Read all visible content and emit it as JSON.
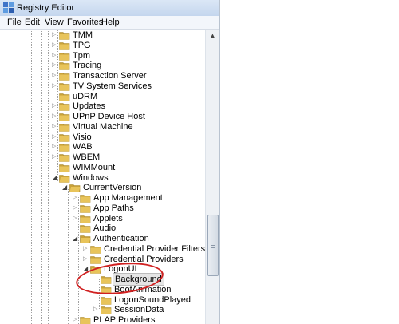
{
  "window": {
    "title": "Registry Editor"
  },
  "menu": [
    {
      "label": "File",
      "mnemonic": "F",
      "rest": "ile"
    },
    {
      "label": "Edit",
      "mnemonic": "E",
      "rest": "dit"
    },
    {
      "label": "View",
      "mnemonic": "V",
      "rest": "iew"
    },
    {
      "label": "Favorites",
      "mnemonic": "a",
      "prefix": "F",
      "rest": "vorites"
    },
    {
      "label": "Help",
      "mnemonic": "H",
      "rest": "elp"
    }
  ],
  "tree": {
    "items": [
      {
        "label": "TMM",
        "expanded": false,
        "has_children": true
      },
      {
        "label": "TPG",
        "expanded": false,
        "has_children": true
      },
      {
        "label": "Tpm",
        "expanded": false,
        "has_children": true
      },
      {
        "label": "Tracing",
        "expanded": false,
        "has_children": true
      },
      {
        "label": "Transaction Server",
        "expanded": false,
        "has_children": true
      },
      {
        "label": "TV System Services",
        "expanded": false,
        "has_children": true
      },
      {
        "label": "uDRM",
        "expanded": false,
        "has_children": false
      },
      {
        "label": "Updates",
        "expanded": false,
        "has_children": true
      },
      {
        "label": "UPnP Device Host",
        "expanded": false,
        "has_children": true
      },
      {
        "label": "Virtual Machine",
        "expanded": false,
        "has_children": true
      },
      {
        "label": "Visio",
        "expanded": false,
        "has_children": true
      },
      {
        "label": "WAB",
        "expanded": false,
        "has_children": true
      },
      {
        "label": "WBEM",
        "expanded": false,
        "has_children": true
      },
      {
        "label": "WIMMount",
        "expanded": false,
        "has_children": false
      },
      {
        "label": "Windows",
        "expanded": true,
        "has_children": true
      },
      {
        "label": "CurrentVersion",
        "expanded": true,
        "has_children": true
      },
      {
        "label": "App Management",
        "expanded": false,
        "has_children": true
      },
      {
        "label": "App Paths",
        "expanded": false,
        "has_children": true
      },
      {
        "label": "Applets",
        "expanded": false,
        "has_children": true
      },
      {
        "label": "Audio",
        "expanded": false,
        "has_children": false
      },
      {
        "label": "Authentication",
        "expanded": true,
        "has_children": true
      },
      {
        "label": "Credential Provider Filters",
        "expanded": false,
        "has_children": true
      },
      {
        "label": "Credential Providers",
        "expanded": false,
        "has_children": true
      },
      {
        "label": "LogonUI",
        "expanded": true,
        "has_children": true
      },
      {
        "label": "Background",
        "expanded": false,
        "has_children": false,
        "selected": true
      },
      {
        "label": "BootAnimation",
        "expanded": false,
        "has_children": false
      },
      {
        "label": "LogonSoundPlayed",
        "expanded": false,
        "has_children": false
      },
      {
        "label": "SessionData",
        "expanded": false,
        "has_children": true
      },
      {
        "label": "PLAP Providers",
        "expanded": false,
        "has_children": true
      }
    ]
  },
  "colors": {
    "folder": "#e8c45a",
    "folder_dark": "#c9a23a",
    "highlight_oval": "#d02020",
    "selection": "#e5e5e5"
  }
}
